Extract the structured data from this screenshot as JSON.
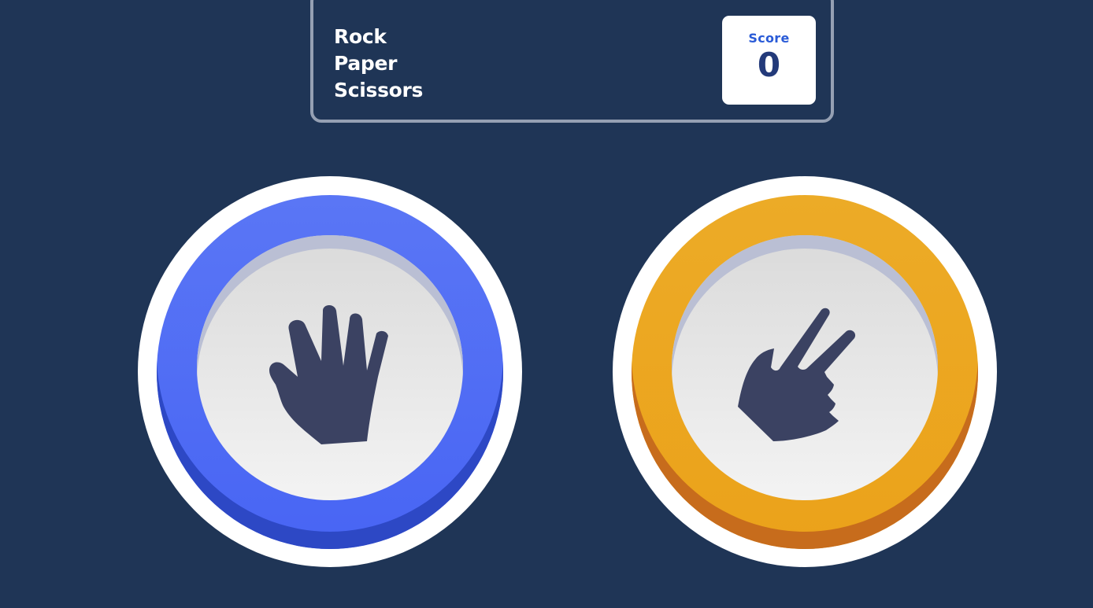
{
  "header": {
    "title_lines": [
      "Rock",
      "Paper",
      "Scissors"
    ],
    "score_label": "Score",
    "score_value": "0"
  },
  "choices": [
    {
      "id": "paper",
      "icon": "paper-hand-icon",
      "ring_color": "#4f6ef5",
      "ring_shadow": "#2d48c5"
    },
    {
      "id": "scissors",
      "icon": "scissors-hand-icon",
      "ring_color": "#eca922",
      "ring_shadow": "#c76c1c"
    }
  ],
  "colors": {
    "background": "#1f3556",
    "header_border": "#95a0b3",
    "icon": "#3b4262",
    "score_label": "#2a5bd7",
    "score_value": "#233a7a"
  }
}
